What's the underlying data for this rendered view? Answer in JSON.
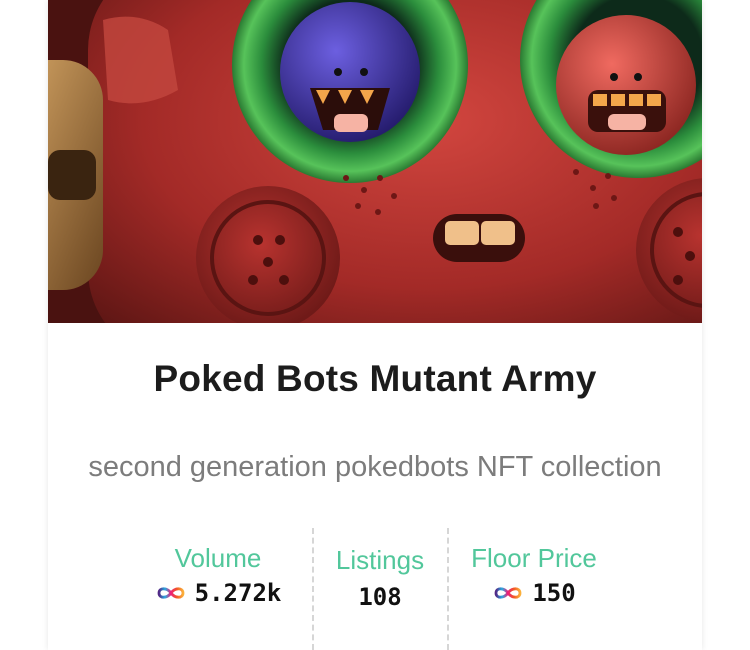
{
  "collection": {
    "title": "Poked Bots Mutant Army",
    "description": "second generation pokedbots NFT collection"
  },
  "stats": {
    "volume": {
      "label": "Volume",
      "value": "5.272k",
      "icon": "icp-infinity-icon"
    },
    "listings": {
      "label": "Listings",
      "value": "108"
    },
    "floor_price": {
      "label": "Floor Price",
      "value": "150",
      "icon": "icp-infinity-icon"
    }
  },
  "colors": {
    "accent": "#52c79b",
    "title": "#1c1c1c",
    "description": "#7c7c7c",
    "icp_gradient": [
      "#29abe2",
      "#522785",
      "#ed1e79",
      "#f15a24",
      "#fbb03b"
    ]
  }
}
